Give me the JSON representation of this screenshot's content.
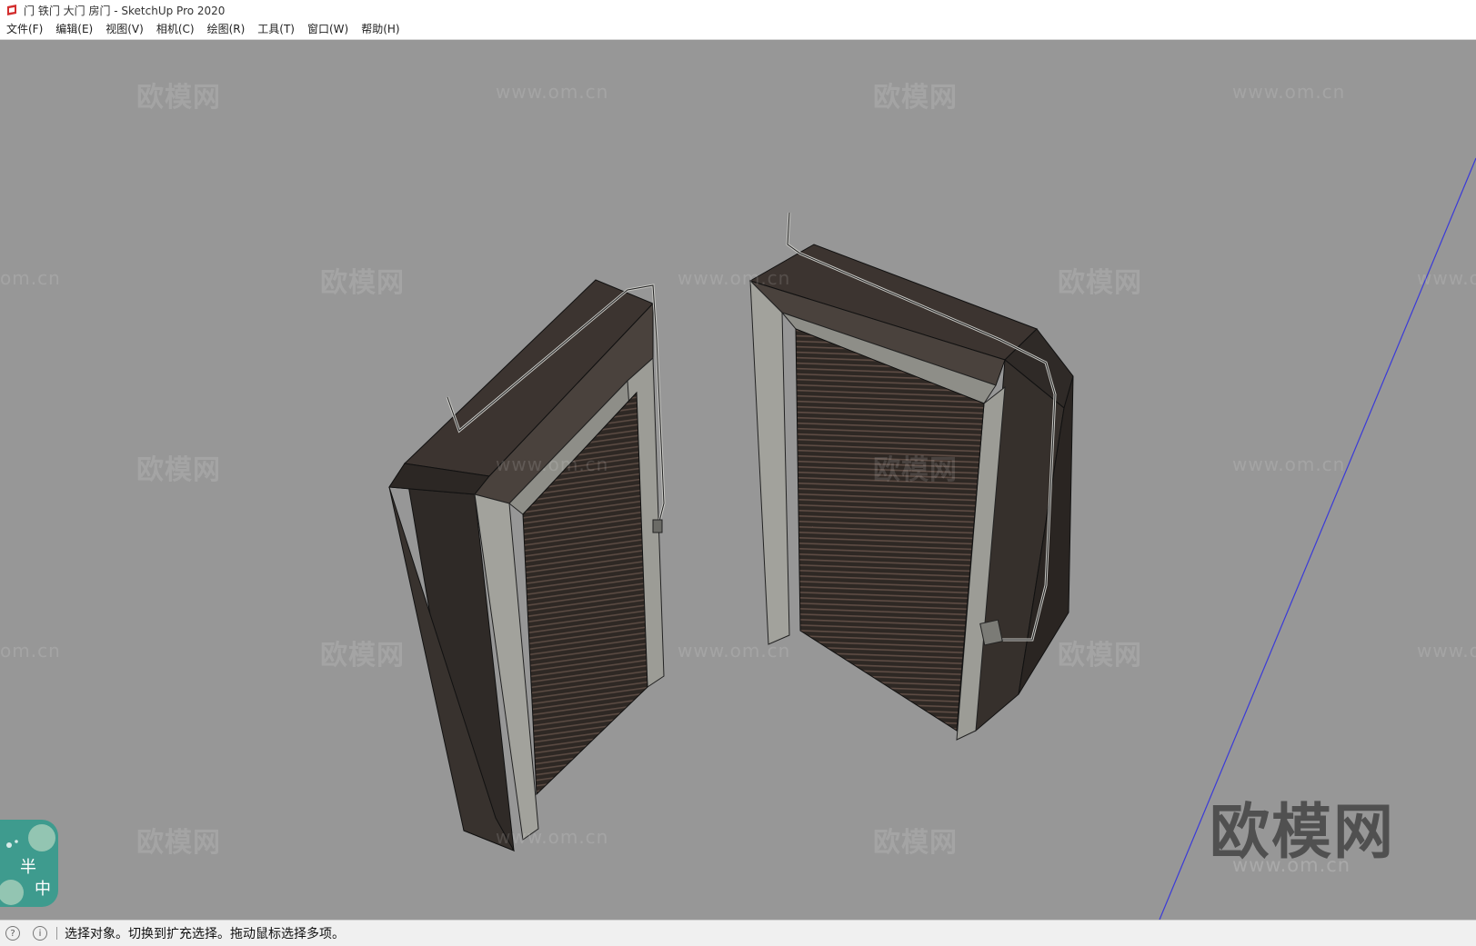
{
  "window": {
    "title": "门 铁门 大门 房门 - SketchUp Pro 2020"
  },
  "menu": {
    "items": [
      {
        "id": "file",
        "label": "文件(F)"
      },
      {
        "id": "edit",
        "label": "编辑(E)"
      },
      {
        "id": "view",
        "label": "视图(V)"
      },
      {
        "id": "camera",
        "label": "相机(C)"
      },
      {
        "id": "draw",
        "label": "绘图(R)"
      },
      {
        "id": "tools",
        "label": "工具(T)"
      },
      {
        "id": "window",
        "label": "窗口(W)"
      },
      {
        "id": "help",
        "label": "帮助(H)"
      }
    ]
  },
  "watermark": {
    "brand": "欧模网",
    "url": "www.om.cn",
    "url_short": "om.cn",
    "url_partial": "www.o"
  },
  "badge": {
    "char1": "半",
    "char2": "中"
  },
  "status": {
    "message": "选择对象。切换到扩充选择。拖动鼠标选择多项。",
    "geo_icon": "globe-icon",
    "info_icon": "info-icon"
  },
  "colors": {
    "viewport_bg": "#979797",
    "axis_blue": "#3a3ad8",
    "frame_dark": "#3a3430",
    "frame_light": "#9a9a94",
    "shutter": "#2b2522"
  }
}
